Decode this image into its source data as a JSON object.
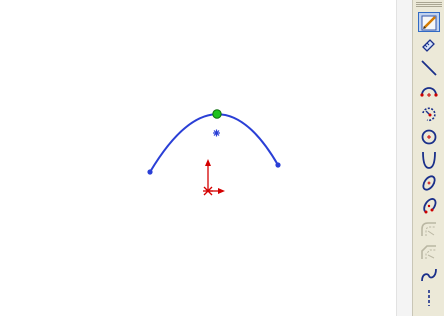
{
  "colors": {
    "canvas": "#ffffff",
    "curve": "#2a3fd6",
    "endpoint": "#2a3fd6",
    "apex_point": "#1fc21f",
    "origin_axis": "#d40000",
    "toolbar_bg": "#ece9d8",
    "active_tool": "#c1d2ee"
  },
  "toolbar": {
    "tools": [
      {
        "name": "sketch",
        "icon": "sketch-pencil-icon",
        "state": "active"
      },
      {
        "name": "smart-dimension",
        "icon": "dimension-icon",
        "state": "normal"
      },
      {
        "name": "line",
        "icon": "line-icon",
        "state": "normal"
      },
      {
        "name": "centerpoint-arc",
        "icon": "centerpoint-arc-icon",
        "state": "normal"
      },
      {
        "name": "tangent-arc",
        "icon": "tangent-arc-icon",
        "state": "normal"
      },
      {
        "name": "circle",
        "icon": "circle-icon",
        "state": "normal"
      },
      {
        "name": "parabola",
        "icon": "parabola-icon",
        "state": "normal"
      },
      {
        "name": "ellipse",
        "icon": "ellipse-icon",
        "state": "normal"
      },
      {
        "name": "partial-ellipse",
        "icon": "partial-ellipse-icon",
        "state": "normal"
      },
      {
        "name": "sketch-fillet",
        "icon": "sketch-fillet-icon",
        "state": "disabled"
      },
      {
        "name": "sketch-chamfer",
        "icon": "sketch-chamfer-icon",
        "state": "disabled"
      },
      {
        "name": "spline",
        "icon": "spline-icon",
        "state": "normal"
      },
      {
        "name": "centerline",
        "icon": "centerline-icon",
        "state": "normal"
      }
    ]
  }
}
